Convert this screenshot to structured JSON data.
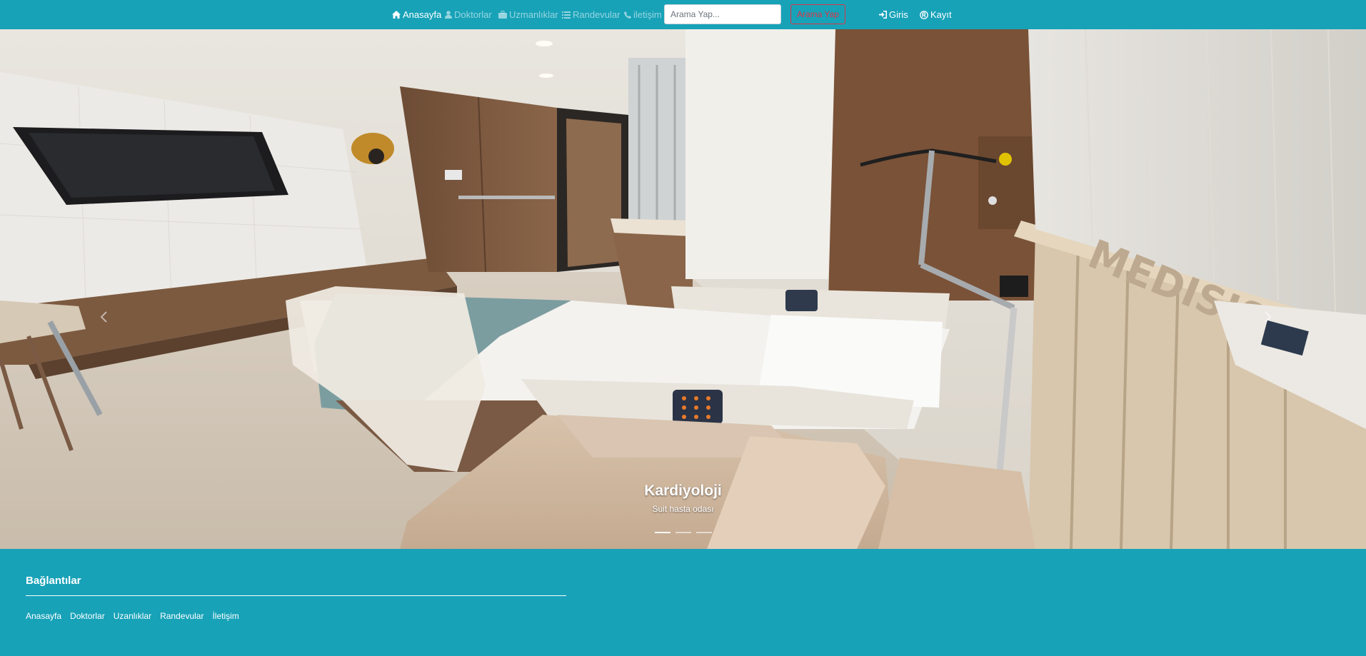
{
  "navbar": {
    "items": [
      {
        "label": "Anasayfa",
        "icon": "home-icon"
      },
      {
        "label": "Doktorlar",
        "icon": "user-icon"
      },
      {
        "label": "Uzmanlıklar",
        "icon": "briefcase-icon"
      },
      {
        "label": "Randevular",
        "icon": "list-icon"
      },
      {
        "label": "iletişim",
        "icon": "phone-icon"
      }
    ],
    "search": {
      "placeholder": "Arama Yap...",
      "value": "",
      "button_label": "Arama Yap"
    },
    "auth": [
      {
        "label": "Giris",
        "icon": "login-icon"
      },
      {
        "label": "Kayıt",
        "icon": "registered-icon"
      }
    ]
  },
  "carousel": {
    "caption_title": "Kardiyoloji",
    "caption_text": "Suit hasta odası",
    "slide_count": 3,
    "active_slide": 1,
    "image_wall_text": "MEDISIS"
  },
  "footer": {
    "title": "Bağlantılar",
    "links": [
      "Anasayfa",
      "Doktorlar",
      "Uzanlıklar",
      "Randevular",
      "İletişim"
    ]
  },
  "colors": {
    "brand": "#17a2b8",
    "danger": "#dc3545",
    "text_light": "#ffffff"
  }
}
